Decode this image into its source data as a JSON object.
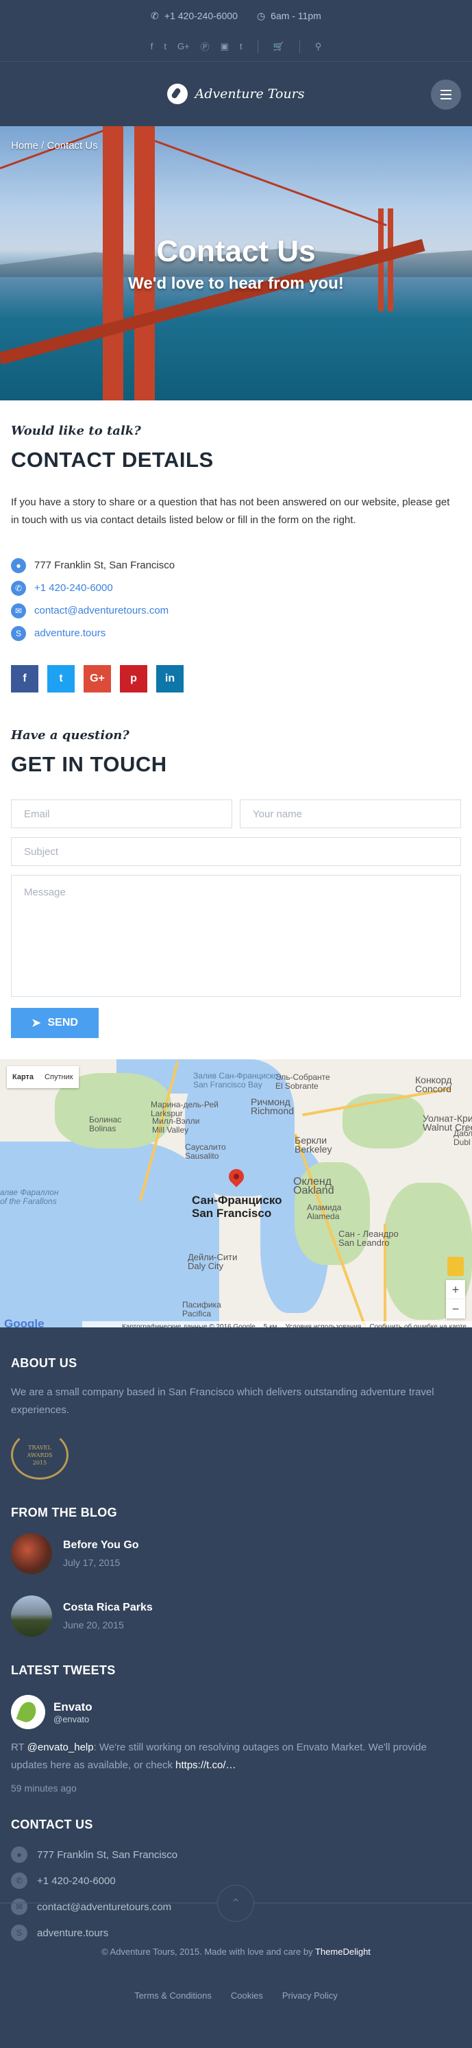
{
  "header": {
    "phone": "+1 420-240-6000",
    "hours": "6am - 11pm",
    "social_icons": [
      "facebook-icon",
      "twitter-icon",
      "google-plus-icon",
      "pinterest-icon",
      "instagram-icon",
      "tumblr-icon"
    ],
    "brand": "Adventure Tours"
  },
  "hero": {
    "breadcrumb": "Home / Contact Us",
    "title": "Contact Us",
    "subtitle": "We'd love to hear from you!"
  },
  "contact": {
    "kicker": "Would like to talk?",
    "title": "CONTACT DETAILS",
    "intro": "If you have a story to share or a question that has not been answered on our website, please get in touch with us via contact details listed below or fill in the form on the right.",
    "address": "777 Franklin St, San Francisco",
    "phone": "+1 420-240-6000",
    "email": "contact@adventuretours.com",
    "skype": "adventure.tours",
    "social": [
      {
        "icon": "facebook-icon",
        "glyph": "f",
        "color": "#3b5998"
      },
      {
        "icon": "twitter-icon",
        "glyph": "t",
        "color": "#1da1f2"
      },
      {
        "icon": "google-plus-icon",
        "glyph": "G+",
        "color": "#dd4b39"
      },
      {
        "icon": "pinterest-icon",
        "glyph": "p",
        "color": "#cb2027"
      },
      {
        "icon": "linkedin-icon",
        "glyph": "in",
        "color": "#0e76a8"
      }
    ]
  },
  "form": {
    "kicker": "Have a question?",
    "title": "GET IN TOUCH",
    "email_placeholder": "Email",
    "name_placeholder": "Your name",
    "subject_placeholder": "Subject",
    "message_placeholder": "Message",
    "send_label": "SEND"
  },
  "map": {
    "toggle_map": "Карта",
    "toggle_sat": "Спутник",
    "attribution": "Картографические данные © 2016 Google",
    "scale": "5 км",
    "terms": "Условия использования",
    "report": "Сообщить об ошибке на карте",
    "google": "Google",
    "labels": {
      "bay": "Залив Сан-Франциско",
      "bay_en": "San Francisco Bay",
      "elsobrante": "Эль-Собранте",
      "elsobrante_en": "El Sobrante",
      "concord": "Конкорд",
      "concord_en": "Concord",
      "richmond": "Ричмонд",
      "richmond_en": "Richmond",
      "marina": "Марина-дель-Рей",
      "larkspur": "Larkspur",
      "mill": "Милл-Вэлли",
      "mill_en": "Mill Valley",
      "bolinas": "Болинас",
      "bolinas_en": "Bolinas",
      "sausalito": "Саусалито",
      "sausalito_en": "Sausalito",
      "walnut": "Уолнат-Крик",
      "walnut_en": "Walnut Creek",
      "berkeley": "Беркли",
      "berkeley_en": "Berkeley",
      "oakland": "Окленд",
      "oakland_en": "Oakland",
      "alameda": "Аламида",
      "alameda_en": "Alameda",
      "sf": "Сан-Франциско",
      "sf_en": "San Francisco",
      "farallon": "алве Фараллон",
      "farallon_en": "of the Farallons",
      "leandro": "Сан - Леандро",
      "leandro_en": "San Leandro",
      "daly": "Дейли-Сити",
      "daly_en": "Daly City",
      "pacifica": "Пасифика",
      "pacifica_en": "Pacifica",
      "dub": "Дабл",
      "dub_en": "Dubl"
    }
  },
  "footer": {
    "about_title": "ABOUT US",
    "about_text": "We are a small company based in San Francisco which delivers outstanding adventure travel experiences.",
    "award_line1": "TRAVEL",
    "award_line2": "AWARDS",
    "award_line3": "2015",
    "blog_title": "FROM THE BLOG",
    "posts": [
      {
        "title": "Before You Go",
        "date": "July 17, 2015"
      },
      {
        "title": "Costa Rica Parks",
        "date": "June 20, 2015"
      }
    ],
    "tweets_title": "LATEST TWEETS",
    "tweet_name": "Envato",
    "tweet_handle": "@envato",
    "tweet_text_pre": "RT ",
    "tweet_mention": "@envato_help",
    "tweet_text": ": We're still working on resolving outages on Envato Market. We'll provide updates here as available, or check ",
    "tweet_link": "https://t.co/…",
    "tweet_time": "59 minutes ago",
    "contact_title": "CONTACT US",
    "address": "777 Franklin St, San Francisco",
    "phone": "+1 420-240-6000",
    "email": "contact@adventuretours.com",
    "skype": "adventure.tours",
    "copyright": "© Adventure Tours, 2015. Made with love and care by",
    "copyright_by": "ThemeDelight",
    "links": [
      "Terms & Conditions",
      "Cookies",
      "Privacy Policy"
    ]
  }
}
